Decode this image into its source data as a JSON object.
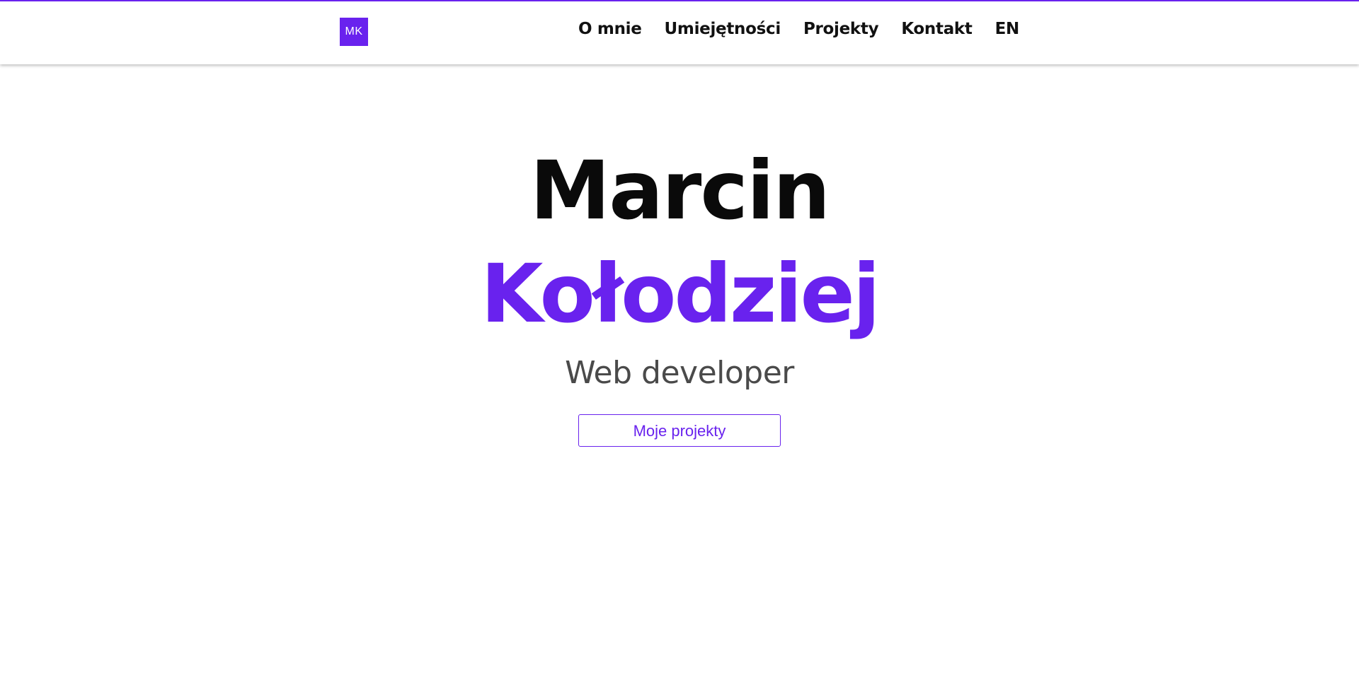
{
  "colors": {
    "accent": "#6922ee",
    "text": "#0a0a0a",
    "muted": "#4a4a4a",
    "background": "#ffffff"
  },
  "header": {
    "logo_text": "MK",
    "nav": [
      {
        "label": "O mnie"
      },
      {
        "label": "Umiejętności"
      },
      {
        "label": "Projekty"
      },
      {
        "label": "Kontakt"
      },
      {
        "label": "EN"
      }
    ]
  },
  "hero": {
    "first_name": "Marcin",
    "last_name": "Kołodziej",
    "role": "Web developer",
    "cta_label": "Moje projekty"
  }
}
